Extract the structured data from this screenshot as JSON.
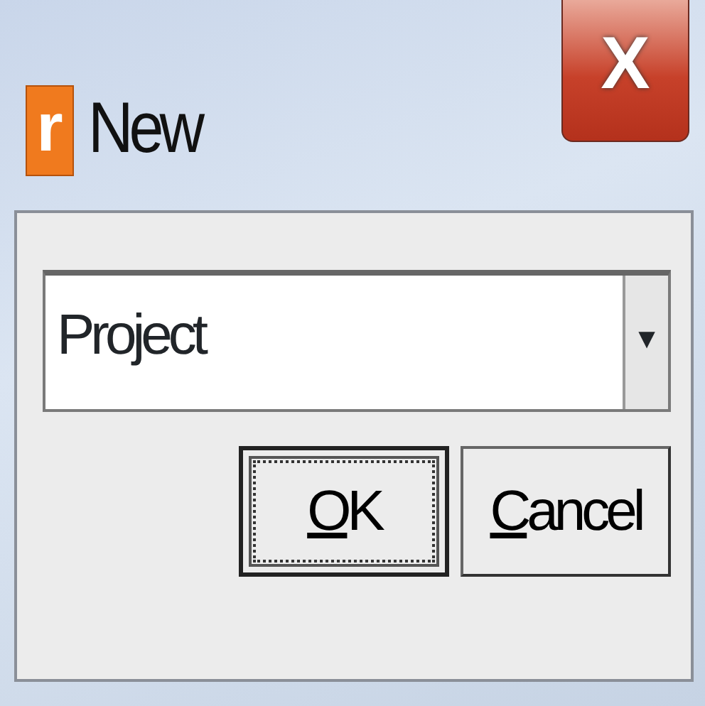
{
  "window": {
    "icon_glyph": "r",
    "title": "New",
    "close_glyph": "X"
  },
  "combo": {
    "value": "Project",
    "arrow": "▼"
  },
  "buttons": [
    {
      "label_parts": [
        {
          "text": "O",
          "underlined": true
        },
        {
          "text": "K",
          "underlined": false
        }
      ],
      "focused": true
    },
    {
      "label_parts": [
        {
          "text": "C",
          "underlined": true
        },
        {
          "text": "ancel",
          "underlined": false
        }
      ],
      "focused": false
    }
  ]
}
